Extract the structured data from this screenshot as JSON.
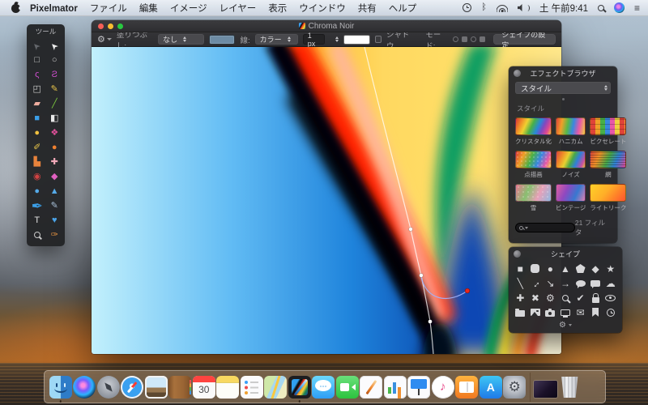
{
  "menu_bar": {
    "items": [
      {
        "label": "Pixelmator",
        "cls": "bold"
      },
      {
        "label": "ファイル"
      },
      {
        "label": "編集"
      },
      {
        "label": "イメージ"
      },
      {
        "label": "レイヤー"
      },
      {
        "label": "表示"
      },
      {
        "label": "ウインドウ"
      },
      {
        "label": "共有"
      },
      {
        "label": "ヘルプ"
      }
    ],
    "clock": "土 午前9:41",
    "icons": {
      "bluetooth": "ᛒ",
      "notification_center": "≡"
    }
  },
  "tools_panel": {
    "title": "ツール",
    "tools": [
      {
        "name": "tool-move",
        "glyph": "➤",
        "color": "#63666b",
        "cls": "rot-ul"
      },
      {
        "name": "tool-arrange",
        "glyph": "➤",
        "color": "#ececec",
        "cls": "rot-ul"
      },
      {
        "name": "tool-rect-select",
        "glyph": "□",
        "color": "#c9c9c9"
      },
      {
        "name": "tool-ellipse-select",
        "glyph": "○",
        "color": "#c9c9c9"
      },
      {
        "name": "tool-lasso",
        "glyph": "ς",
        "color": "#d14fd1"
      },
      {
        "name": "tool-polygon-lasso",
        "glyph": "Ƨ",
        "color": "#d14fd1"
      },
      {
        "name": "tool-transform",
        "glyph": "◰",
        "color": "#c9c9c9"
      },
      {
        "name": "tool-pencil",
        "glyph": "✎",
        "color": "#e8c44a"
      },
      {
        "name": "tool-eraser",
        "glyph": "▰",
        "color": "#eead9f"
      },
      {
        "name": "tool-slice",
        "glyph": "╱",
        "color": "#7cc93f"
      },
      {
        "name": "tool-fill",
        "glyph": "■",
        "color": "#3b9fe8"
      },
      {
        "name": "tool-gradient",
        "glyph": "◧",
        "color": "#e8e8e8"
      },
      {
        "name": "tool-dodge",
        "glyph": "●",
        "color": "#f0c040"
      },
      {
        "name": "tool-pixel-brush",
        "glyph": "❖",
        "color": "#e0509a"
      },
      {
        "name": "tool-smudge",
        "glyph": "✐",
        "color": "#e8c44a"
      },
      {
        "name": "tool-blur",
        "glyph": "●",
        "color": "#f08030"
      },
      {
        "name": "tool-stamp",
        "glyph": "▙",
        "color": "#e8833c"
      },
      {
        "name": "tool-heal",
        "glyph": "✚",
        "color": "#f2a9b9"
      },
      {
        "name": "tool-red-eye",
        "glyph": "◉",
        "color": "#d24242"
      },
      {
        "name": "tool-magic-wand",
        "glyph": "◆",
        "color": "#e060c0"
      },
      {
        "name": "tool-sponge",
        "glyph": "●",
        "color": "#55aae8"
      },
      {
        "name": "tool-sharpen",
        "glyph": "▲",
        "color": "#55aae8"
      },
      {
        "name": "tool-vector-pen",
        "glyph": "✒",
        "color": "#3b9fe8",
        "cls": "big-tool"
      },
      {
        "name": "tool-paint-brush",
        "glyph": "✎",
        "color": "#a8c0d8"
      },
      {
        "name": "tool-type",
        "glyph": "T",
        "color": "#e0e0e0"
      },
      {
        "name": "tool-shape",
        "glyph": "♥",
        "color": "#4aa3e8"
      },
      {
        "name": "tool-zoom",
        "glyph": "",
        "color": "#c9c9c9",
        "cls": "i-mag"
      },
      {
        "name": "tool-eyedropper",
        "glyph": "✑",
        "color": "#e09040"
      }
    ]
  },
  "window": {
    "title": "Chroma Noir",
    "toolbar": {
      "gear": "⚙",
      "fill_label": "塗りつぶし:",
      "fill_value": "なし",
      "stroke_label": "線:",
      "stroke_value": "カラー",
      "stroke_width": "1 px",
      "shadow_label": "シャドウ",
      "mode_label": "モード:",
      "settings_button": "シェイプの設定"
    }
  },
  "effects_panel": {
    "title": "エフェクトブラウザ",
    "style_dropdown": "スタイル",
    "section_label": "スタイル",
    "count_label": "21 フィルタ",
    "filters": [
      {
        "name": "filter-crystallize",
        "label": "クリスタル化",
        "cls": "f-crystal"
      },
      {
        "name": "filter-honeycomb",
        "label": "ハニカム",
        "cls": "f-honey"
      },
      {
        "name": "filter-pixelate",
        "label": "ピクセレート",
        "cls": "f-pixel"
      },
      {
        "name": "filter-pointillize",
        "label": "点描画",
        "cls": "f-point"
      },
      {
        "name": "filter-noise",
        "label": "ノイズ",
        "cls": "f-noise"
      },
      {
        "name": "filter-mesh",
        "label": "網",
        "cls": "f-mesh"
      },
      {
        "name": "filter-snow",
        "label": "雪",
        "cls": "f-snow"
      },
      {
        "name": "filter-vintage",
        "label": "ビンテージ",
        "cls": "f-vintage"
      },
      {
        "name": "filter-light-leak",
        "label": "ライトリーク",
        "cls": "f-leak"
      }
    ]
  },
  "shapes_panel": {
    "title": "シェイプ",
    "shapes": [
      {
        "name": "shape-square",
        "glyph": "■"
      },
      {
        "name": "shape-rounded-square",
        "glyph": "",
        "cls": "i-rsq"
      },
      {
        "name": "shape-circle",
        "glyph": "●"
      },
      {
        "name": "shape-triangle",
        "glyph": "▲"
      },
      {
        "name": "shape-pentagon",
        "glyph": "",
        "cls": "i-pent"
      },
      {
        "name": "shape-diamond",
        "glyph": "◆"
      },
      {
        "name": "shape-star",
        "glyph": "★"
      },
      {
        "name": "shape-line",
        "glyph": "╲"
      },
      {
        "name": "shape-arrow-two-headed",
        "glyph": "↔",
        "cls": "rot-45"
      },
      {
        "name": "shape-arrow-diagonal",
        "glyph": "↘"
      },
      {
        "name": "shape-arrow-right",
        "glyph": "→",
        "cls": "bold-g"
      },
      {
        "name": "shape-speech-bubble-round",
        "glyph": "",
        "cls": "i-bub-r"
      },
      {
        "name": "shape-speech-bubble-square",
        "glyph": "",
        "cls": "i-bub-s"
      },
      {
        "name": "shape-cloud",
        "glyph": "☁"
      },
      {
        "name": "shape-plus",
        "glyph": "✚"
      },
      {
        "name": "shape-cross",
        "glyph": "✖"
      },
      {
        "name": "shape-gear",
        "glyph": "⚙"
      },
      {
        "name": "shape-magnifier",
        "glyph": "",
        "cls": "i-mag"
      },
      {
        "name": "shape-checkmark",
        "glyph": "✔"
      },
      {
        "name": "shape-lock",
        "glyph": "",
        "cls": "i-lock"
      },
      {
        "name": "shape-eye",
        "glyph": "",
        "cls": "i-eye"
      },
      {
        "name": "shape-folder",
        "glyph": "",
        "cls": "i-folder"
      },
      {
        "name": "shape-picture",
        "glyph": "",
        "cls": "i-image"
      },
      {
        "name": "shape-camera",
        "glyph": "",
        "cls": "i-camera"
      },
      {
        "name": "shape-display",
        "glyph": "",
        "cls": "i-display"
      },
      {
        "name": "shape-envelope",
        "glyph": "✉"
      },
      {
        "name": "shape-bookmark",
        "glyph": "",
        "cls": "i-bookmark"
      },
      {
        "name": "shape-clock",
        "glyph": "",
        "cls": "i-clock"
      }
    ]
  },
  "dock": {
    "apps": [
      {
        "name": "dock-finder",
        "cls": "d-finder running",
        "label": ""
      },
      {
        "name": "dock-siri",
        "cls": "d-siri",
        "label": ""
      },
      {
        "name": "dock-launchpad",
        "cls": "d-launchpad",
        "label": ""
      },
      {
        "name": "dock-safari",
        "cls": "d-safari",
        "label": ""
      },
      {
        "name": "dock-photos",
        "cls": "d-photos",
        "label": ""
      },
      {
        "name": "dock-contacts",
        "cls": "d-contacts",
        "label": ""
      },
      {
        "name": "dock-calendar",
        "cls": "d-calendar",
        "label": "30"
      },
      {
        "name": "dock-notes",
        "cls": "d-notes",
        "label": ""
      },
      {
        "name": "dock-reminders",
        "cls": "d-reminders",
        "label": ""
      },
      {
        "name": "dock-maps",
        "cls": "d-maps",
        "label": ""
      },
      {
        "name": "dock-pixelmator",
        "cls": "d-pixelmator running",
        "label": ""
      },
      {
        "name": "dock-messages",
        "cls": "d-messages",
        "label": ""
      },
      {
        "name": "dock-facetime",
        "cls": "d-facetime",
        "label": ""
      },
      {
        "name": "dock-pages",
        "cls": "d-pages",
        "label": ""
      },
      {
        "name": "dock-numbers",
        "cls": "d-numbers",
        "label": ""
      },
      {
        "name": "dock-keynote",
        "cls": "d-keynote",
        "label": ""
      },
      {
        "name": "dock-itunes",
        "cls": "d-itunes",
        "label": ""
      },
      {
        "name": "dock-ibooks",
        "cls": "d-ibooks",
        "label": ""
      },
      {
        "name": "dock-appstore",
        "cls": "d-appstore",
        "label": ""
      },
      {
        "name": "dock-system-preferences",
        "cls": "d-sysprefs",
        "label": ""
      },
      {
        "name": "dock-divider",
        "cls": "d-divider",
        "label": ""
      },
      {
        "name": "dock-minimized-window",
        "cls": "d-window",
        "label": ""
      },
      {
        "name": "dock-trash",
        "cls": "d-trash",
        "label": ""
      }
    ]
  },
  "colors": {
    "accent_blue": "#3b9fe8",
    "fill_swatch": "#6d8ba4",
    "stroke_swatch": "#ffffff",
    "panel_bg": "#28282b"
  }
}
